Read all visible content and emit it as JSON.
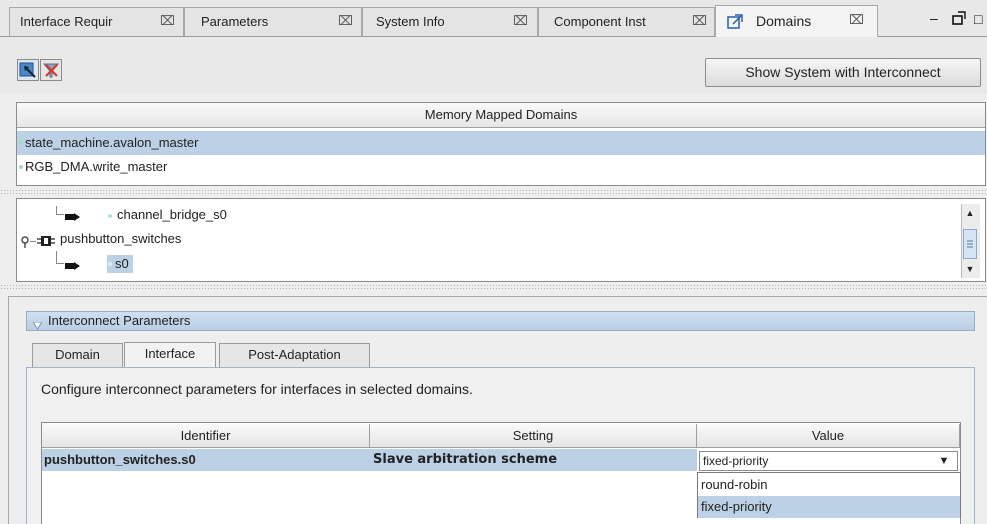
{
  "tabs": [
    {
      "label": "Interface Requir",
      "close": "⌧"
    },
    {
      "label": "Parameters",
      "close": "⌧"
    },
    {
      "label": "System Info",
      "close": "⌧"
    },
    {
      "label": "Component Inst",
      "close": "⌧"
    },
    {
      "label": "Domains",
      "close": "⌧",
      "icon": "domains-icon"
    }
  ],
  "window_controls": {
    "minimize": "–",
    "restore": "□"
  },
  "toolbar": {
    "icons": [
      "select-domain-icon",
      "clear-filter-icon"
    ],
    "show_system_button": "Show System with Interconnect"
  },
  "memory_domains": {
    "header": "Memory Mapped Domains",
    "rows": [
      "state_machine.avalon_master",
      "RGB_DMA.write_master"
    ],
    "selected_index": 0
  },
  "tree": {
    "items": [
      {
        "label": "channel_bridge_s0",
        "icon": "slave-port-icon"
      },
      {
        "label": "pushbutton_switches",
        "icon": "component-icon"
      },
      {
        "label": "s0",
        "icon": "slave-port-icon",
        "selected": true
      }
    ]
  },
  "interconnect": {
    "title": "Interconnect Parameters",
    "tabs": [
      "Domain",
      "Interface",
      "Post-Adaptation"
    ],
    "active_tab": "Interface",
    "description": "Configure interconnect parameters for interfaces in selected domains.",
    "table": {
      "headers": [
        "Identifier",
        "Setting",
        "Value"
      ],
      "row": {
        "identifier": "pushbutton_switches.s0",
        "setting": "Slave arbitration scheme",
        "value": "fixed-priority"
      }
    },
    "dropdown_options": [
      "round-robin",
      "fixed-priority"
    ],
    "dropdown_selected": "fixed-priority"
  },
  "colors": {
    "selection": "#bcd1e6",
    "section_header": "#c5d8eb"
  }
}
